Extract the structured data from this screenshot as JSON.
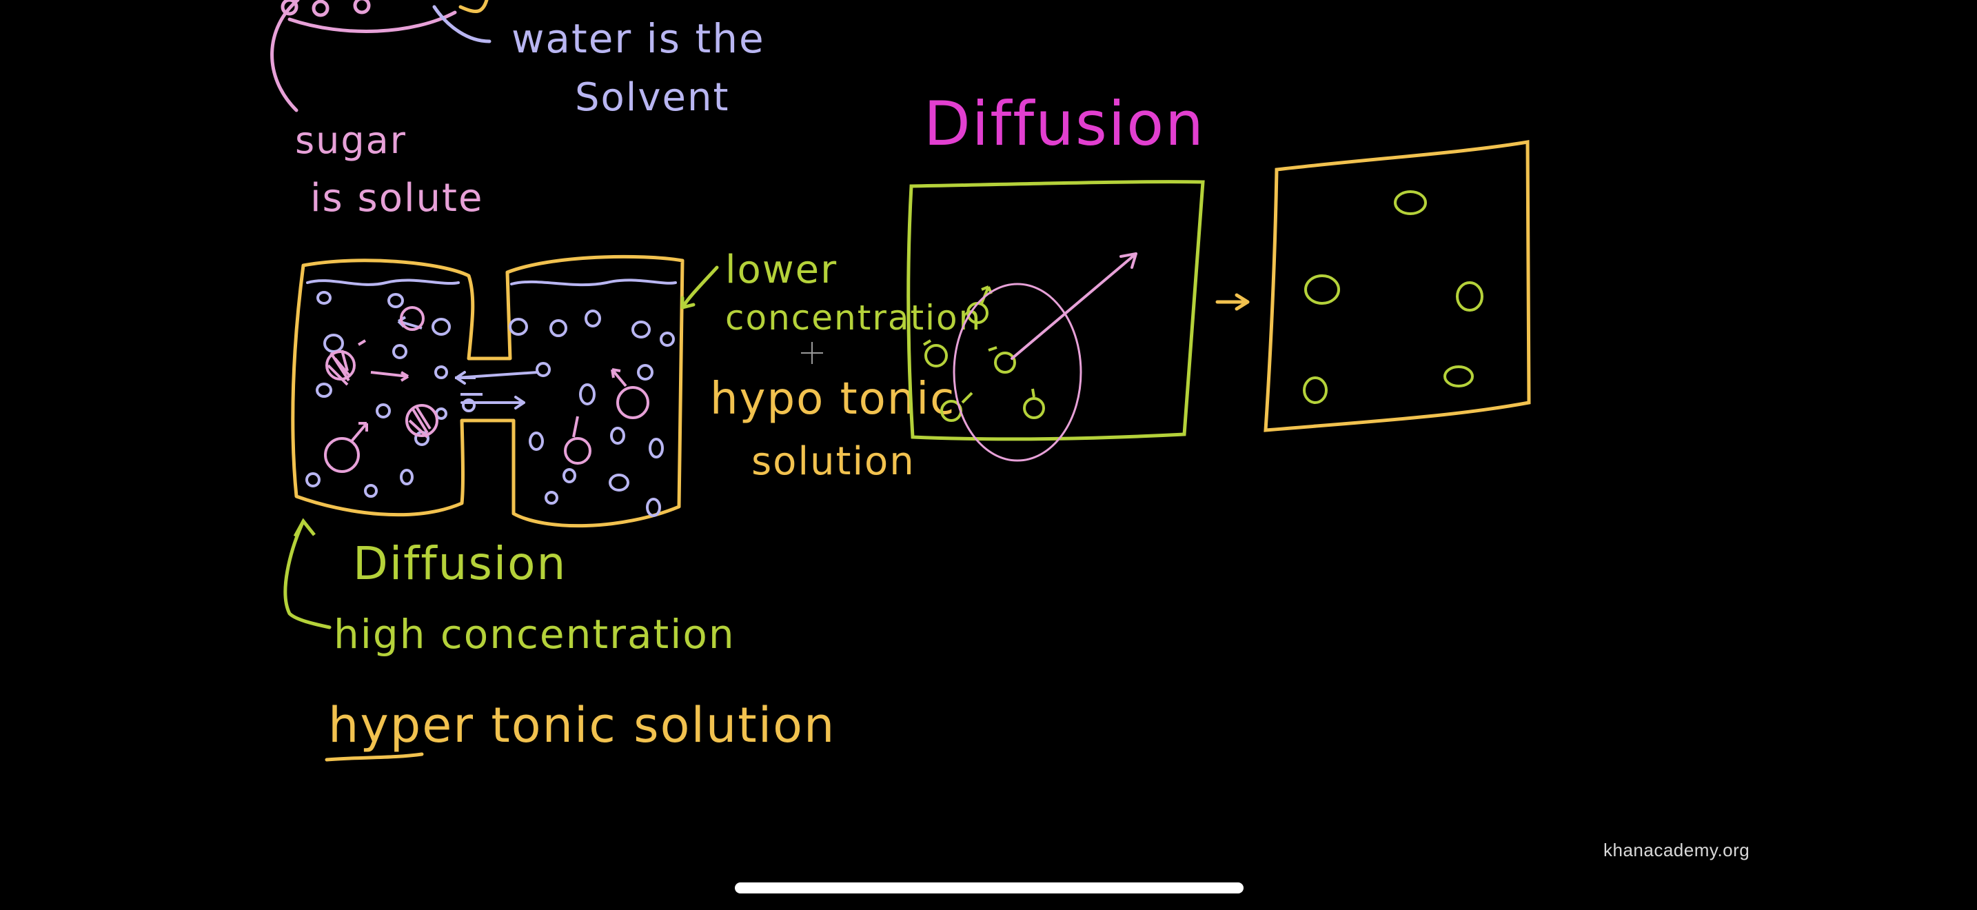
{
  "colors": {
    "background": "#000000",
    "pink": "#e7a1d8",
    "lavender": "#b9b6f2",
    "yellow": "#f2c24f",
    "green": "#b5d23a",
    "magenta": "#e23fd0",
    "white": "#ffffff"
  },
  "labels": {
    "water_is_the": "water is the",
    "solvent": "Solvent",
    "sugar": "sugar",
    "is_solute": "is solute",
    "diffusion_title": "Diffusion",
    "lower_concentration_1": "lower",
    "lower_concentration_2": "concentration",
    "hypotonic_1": "hypo tonic",
    "hypotonic_2": "solution",
    "diffusion_label": "Diffusion",
    "high_concentration": "high concentration",
    "hypertonic_solution": "hyper tonic solution"
  },
  "watermark": "khanacademy.org",
  "icons": {
    "cursor": "crosshair-icon",
    "arrow": "arrow-right-icon"
  }
}
